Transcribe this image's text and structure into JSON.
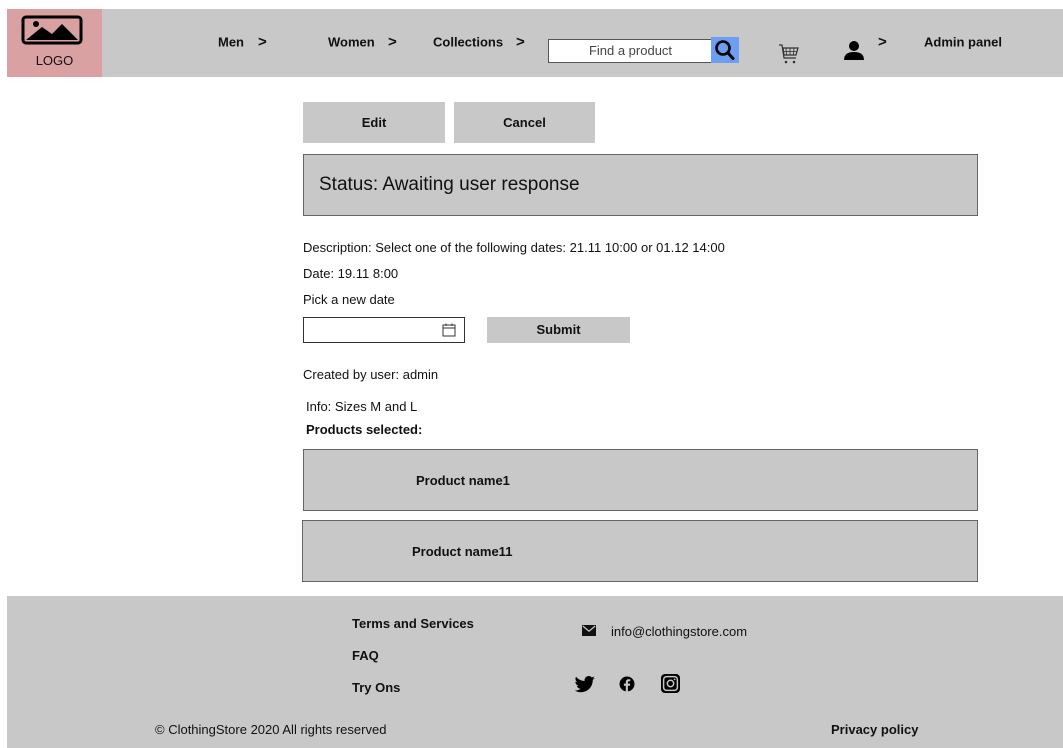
{
  "header": {
    "logo_text": "LOGO",
    "nav": [
      {
        "label": "Men",
        "chevron": ">"
      },
      {
        "label": "Women",
        "chevron": ">"
      },
      {
        "label": "Collections",
        "chevron": ">"
      }
    ],
    "search_placeholder": "Find a product",
    "account_chevron": ">",
    "admin_label": "Admin panel",
    "icons": {
      "logo": "image-placeholder-icon",
      "search": "search-icon",
      "cart": "cart-icon",
      "user": "user-icon"
    },
    "search_button_color": "#6c9ef2"
  },
  "actions": {
    "edit_label": "Edit",
    "cancel_label": "Cancel"
  },
  "status": {
    "text": "Status: Awaiting user response"
  },
  "details": {
    "description": "Description: Select one of the following dates: 21.11 10:00 or 01.12 14:00",
    "date": "Date: 19.11 8:00",
    "pick_label": "Pick a new date",
    "date_value": "",
    "submit_label": "Submit",
    "created_by": "Created by user: admin",
    "info": "Info: Sizes M and L",
    "products_heading": "Products selected:"
  },
  "products": [
    {
      "name": "Product name1"
    },
    {
      "name": "Product name11"
    }
  ],
  "footer": {
    "links": [
      "Terms and Services",
      "FAQ",
      "Try Ons"
    ],
    "email": "info@clothingstore.com",
    "social_icons": [
      "twitter-icon",
      "facebook-icon",
      "instagram-icon"
    ],
    "copyright": "© ClothingStore 2020 All rights reserved",
    "privacy": "Privacy policy"
  },
  "colors": {
    "panel_gray": "#c8c8c8",
    "logo_bg": "#d9a1a1"
  }
}
